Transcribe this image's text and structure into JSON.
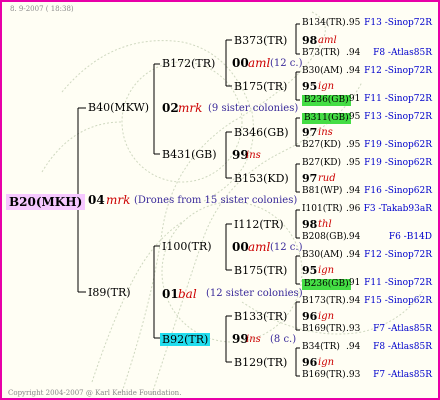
{
  "header": {
    "date": "8. 9-2007 ( 18:38)"
  },
  "footer": {
    "copyright": "Copyright 2004-2007 @ Karl Kehide Foundation."
  },
  "colors": {
    "frame": "#e800a8",
    "root_highlight": "#f6c8ff",
    "green_highlight": "#44dd44",
    "cyan_highlight": "#22ddee",
    "breeder": "#cc0000",
    "note": "#3a2a9a",
    "reference": "#0000cc"
  },
  "root": {
    "name": "B20(MKH)",
    "year": "04",
    "breeder": "mrk",
    "note": "(Drones from 15 sister colonies)"
  },
  "g1": [
    {
      "name": "B40(MKW)",
      "year": "02",
      "breeder": "mrk",
      "note": "(9 sister colonies)"
    },
    {
      "name": "I89(TR)",
      "year": "01",
      "breeder": "bal",
      "note": "(12 sister colonies)"
    }
  ],
  "g2": [
    {
      "name": "B172(TR)",
      "year": "00",
      "breeder": "aml",
      "note": "(12 c.)"
    },
    {
      "name": "B431(GB)",
      "year": "99",
      "breeder": "ins",
      "note": ""
    },
    {
      "name": "I100(TR)",
      "year": "00",
      "breeder": "aml",
      "note": "(12 c.)"
    },
    {
      "name": "B92(TR)",
      "year": "99",
      "breeder": "ins",
      "note": "(8 c.)"
    }
  ],
  "g3": [
    {
      "name": "B373(TR)",
      "year": "98",
      "breeder": "aml"
    },
    {
      "name": "B175(TR)",
      "year": "95",
      "breeder": "ign"
    },
    {
      "name": "B346(GB)",
      "year": "97",
      "breeder": "ins"
    },
    {
      "name": "B153(KD)",
      "year": "97",
      "breeder": "rud"
    },
    {
      "name": "I112(TR)",
      "year": "98",
      "breeder": "thl"
    },
    {
      "name": "B175(TR)",
      "year": "95",
      "breeder": "ign"
    },
    {
      "name": "B133(TR)",
      "year": "96",
      "breeder": "ign"
    },
    {
      "name": "B129(TR)",
      "year": "96",
      "breeder": "ign"
    }
  ],
  "g4": [
    {
      "name": "B134(TR)",
      "score": ".95",
      "ref": "F13 -Sinop72R",
      "hl": ""
    },
    {
      "name": "B73(TR)",
      "score": ".94",
      "ref": "F8 -Atlas85R",
      "hl": ""
    },
    {
      "name": "B30(AM)",
      "score": ".94",
      "ref": "F12 -Sinop72R",
      "hl": ""
    },
    {
      "name": "B236(GB)",
      "score": ".91",
      "ref": "F11 -Sinop72R",
      "hl": "green"
    },
    {
      "name": "B311(GB)",
      "score": ".95",
      "ref": "F13 -Sinop72R",
      "hl": "green"
    },
    {
      "name": "B27(KD)",
      "score": ".95",
      "ref": "F19 -Sinop62R",
      "hl": ""
    },
    {
      "name": "B27(KD)",
      "score": ".95",
      "ref": "F19 -Sinop62R",
      "hl": ""
    },
    {
      "name": "B81(WP)",
      "score": ".94",
      "ref": "F16 -Sinop62R",
      "hl": ""
    },
    {
      "name": "I101(TR)",
      "score": ".96",
      "ref": "F3 -Takab93aR",
      "hl": ""
    },
    {
      "name": "B208(GB)",
      "score": ".94",
      "ref": "F6 -B14D",
      "hl": ""
    },
    {
      "name": "B30(AM)",
      "score": ".94",
      "ref": "F12 -Sinop72R",
      "hl": ""
    },
    {
      "name": "B236(GB)",
      "score": ".91",
      "ref": "F11 -Sinop72R",
      "hl": "green"
    },
    {
      "name": "B173(TR)",
      "score": ".94",
      "ref": "F15 -Sinop62R",
      "hl": ""
    },
    {
      "name": "B169(TR)",
      "score": ".93",
      "ref": "F7 -Atlas85R",
      "hl": ""
    },
    {
      "name": "B34(TR)",
      "score": ".94",
      "ref": "F8 -Atlas85R",
      "hl": ""
    },
    {
      "name": "B169(TR)",
      "score": ".93",
      "ref": "F7 -Atlas85R",
      "hl": ""
    }
  ]
}
